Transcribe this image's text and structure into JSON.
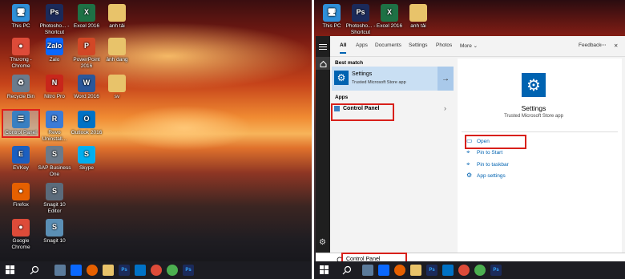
{
  "left_desktop": {
    "icons": [
      {
        "label": "This PC",
        "glyph": "🖥",
        "color": "#2f8fd8"
      },
      {
        "label": "Photosho... - Shortcut",
        "glyph": "Ps",
        "color": "#1b2a5a"
      },
      {
        "label": "Excel 2016",
        "glyph": "X",
        "color": "#1e7145"
      },
      {
        "label": "anh tải",
        "glyph": "",
        "color": "#e8c36a"
      },
      {
        "label": "Thương - Chrome",
        "glyph": "●",
        "color": "#dd4b39"
      },
      {
        "label": "Zalo",
        "glyph": "Zalo",
        "color": "#0a68fe"
      },
      {
        "label": "PowerPoint 2016",
        "glyph": "P",
        "color": "#d24726"
      },
      {
        "label": "ảnh dang",
        "glyph": "",
        "color": "#e8c36a"
      },
      {
        "label": "Recycle Bin",
        "glyph": "♻",
        "color": "#6b7b8c"
      },
      {
        "label": "Nitro Pro",
        "glyph": "N",
        "color": "#c8261b"
      },
      {
        "label": "Word 2016",
        "glyph": "W",
        "color": "#2b579a"
      },
      {
        "label": "sv",
        "glyph": "",
        "color": "#e8c36a"
      },
      {
        "label": "Control Panel",
        "glyph": "☰",
        "color": "#3a7fc1"
      },
      {
        "label": "Revo Uninstall...",
        "glyph": "R",
        "color": "#3b7bd6"
      },
      {
        "label": "Outlook 2016",
        "glyph": "O",
        "color": "#0072c6"
      },
      {
        "label": "EVKey",
        "glyph": "E",
        "color": "#1c5fbf"
      },
      {
        "label": "SAP Business One",
        "glyph": "S",
        "color": "#6c7a89"
      },
      {
        "label": "Skype",
        "glyph": "S",
        "color": "#00aff0"
      },
      {
        "label": "Firefox",
        "glyph": "●",
        "color": "#e66000"
      },
      {
        "label": "Snagit 10 Editor",
        "glyph": "S",
        "color": "#5b6b7b"
      },
      {
        "label": "Google Chrome",
        "glyph": "●",
        "color": "#dd4b39"
      },
      {
        "label": "Snagit 10",
        "glyph": "S",
        "color": "#5b8fb5"
      }
    ]
  },
  "right_desktop": {
    "icons": [
      {
        "label": "This PC",
        "glyph": "🖥",
        "color": "#2f8fd8"
      },
      {
        "label": "Photosho... - Shortcut",
        "glyph": "Ps",
        "color": "#1b2a5a"
      },
      {
        "label": "Excel 2016",
        "glyph": "X",
        "color": "#1e7145"
      },
      {
        "label": "anh tải",
        "glyph": "",
        "color": "#e8c36a"
      }
    ]
  },
  "search": {
    "tabs": [
      "All",
      "Apps",
      "Documents",
      "Settings",
      "Photos",
      "More ⌄"
    ],
    "feedback": "Feedback",
    "more_icon": "···",
    "close_icon": "✕",
    "best_match_header": "Best match",
    "best_match_title": "Settings",
    "best_match_sub": "Trusted Microsoft Store app",
    "apps_header": "Apps",
    "app_item": "Control Panel",
    "detail_title": "Settings",
    "detail_sub": "Trusted Microsoft Store app",
    "actions": [
      "Open",
      "Pin to Start",
      "Pin to taskbar",
      "App settings"
    ],
    "query": "Control Panel"
  },
  "colors": {
    "accent": "#0063b1",
    "highlight": "#d8201a"
  }
}
